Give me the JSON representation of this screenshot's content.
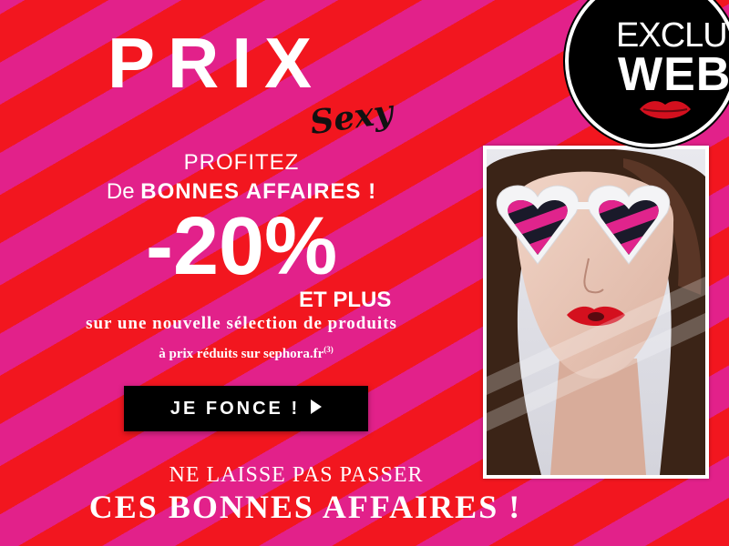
{
  "logo": {
    "main": "PRIX",
    "sub": "Sexy"
  },
  "headline": {
    "line1": "PROFITEZ",
    "line2_prefix": "De ",
    "line2_bold": "BONNES AFFAIRES !",
    "discount": "-20%",
    "discount_suffix": "ET PLUS",
    "selection": "sur une nouvelle sélection de produits",
    "site_text": "à prix réduits sur sephora.fr",
    "footnote": "(3)"
  },
  "cta": {
    "label": "JE FONCE !",
    "icon": "play-arrow-icon"
  },
  "tagline": {
    "line1": "NE LAISSE PAS PASSER",
    "line2": "CES BONNES AFFAIRES !"
  },
  "badge": {
    "line1": "EXCLU",
    "line2": "WEB",
    "icon": "lips-icon"
  },
  "photo": {
    "subject": "woman-with-heart-sunglasses"
  },
  "colors": {
    "stripe_red": "#f2161f",
    "stripe_pink": "#e2218a",
    "text": "#ffffff",
    "button_bg": "#000000",
    "badge_bg": "#000000",
    "lips": "#d4101e"
  }
}
